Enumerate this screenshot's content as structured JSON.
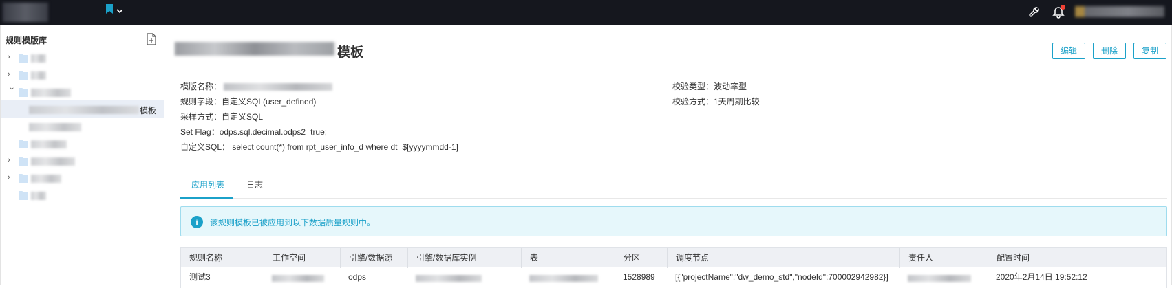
{
  "sidebar": {
    "title": "规则模版库",
    "selected_item_suffix": "模板"
  },
  "header": {
    "title_suffix": "模板",
    "buttons": {
      "edit": "编辑",
      "delete": "删除",
      "copy": "复制"
    }
  },
  "info": {
    "template_name_label": "模版名称：",
    "rule_field": "规则字段：自定义SQL(user_defined)",
    "sampling": "采样方式：自定义SQL",
    "set_flag": "Set Flag：odps.sql.decimal.odps2=true;",
    "custom_sql": "自定义SQL： select count(*) from rpt_user_info_d where dt=$[yyyymmdd-1]",
    "check_type": "校验类型：波动率型",
    "check_method": "校验方式：1天周期比较"
  },
  "tabs": [
    {
      "label": "应用列表"
    },
    {
      "label": "日志"
    }
  ],
  "alert": {
    "text": "该规则模板已被应用到以下数据质量规则中。"
  },
  "table": {
    "headers": [
      "规则名称",
      "工作空间",
      "引擎/数据源",
      "引擎/数据库实例",
      "表",
      "分区",
      "调度节点",
      "责任人",
      "配置时间"
    ],
    "rows": [
      {
        "rule_name": "测试3",
        "engine": "odps",
        "partition": "1528989",
        "schedule_node": "[{\"projectName\":\"dw_demo_std\",\"nodeId\":700002942982}]",
        "config_time": "2020年2月14日 19:52:12"
      }
    ]
  },
  "colors": {
    "accent": "#1ba1c9",
    "topbar": "#15171e",
    "alert_bg": "#e6f7fb",
    "notification_dot": "#f04134"
  }
}
